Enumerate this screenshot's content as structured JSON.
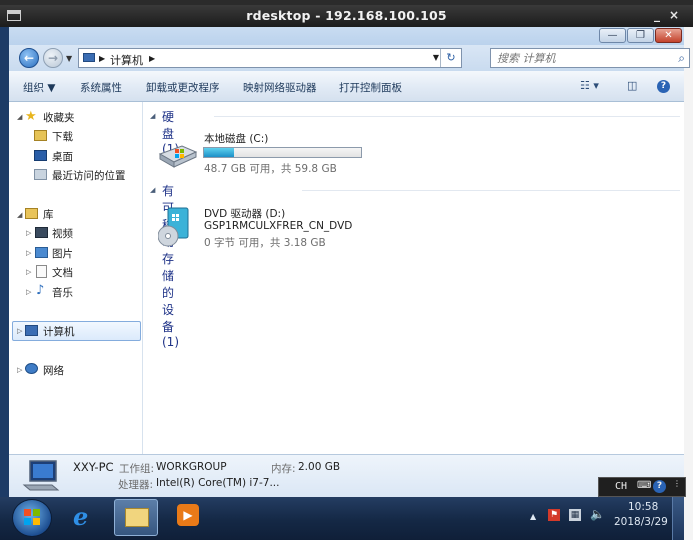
{
  "rdesktop": {
    "title": "rdesktop - 192.168.100.105",
    "minimize": "_",
    "close": "×"
  },
  "address": {
    "crumb": "计算机",
    "search_placeholder": "搜索 计算机"
  },
  "toolbar": {
    "organize": "组织 ▼",
    "properties": "系统属性",
    "uninstall": "卸载或更改程序",
    "map_drive": "映射网络驱动器",
    "control_panel": "打开控制面板"
  },
  "nav": {
    "favorites": "收藏夹",
    "downloads": "下载",
    "desktop": "桌面",
    "recent": "最近访问的位置",
    "libraries": "库",
    "videos": "视频",
    "pictures": "图片",
    "documents": "文档",
    "music": "音乐",
    "computer": "计算机",
    "network": "网络"
  },
  "content": {
    "hdd_group": "硬盘 (1)",
    "removable_group": "有可移动存储的设备 (1)",
    "local_disk_name": "本地磁盘 (C:)",
    "local_disk_space": "48.7 GB 可用，共 59.8 GB",
    "local_disk_used_fraction": 0.19,
    "dvd_name": "DVD 驱动器 (D:)",
    "dvd_label": "GSP1RMCULXFRER_CN_DVD",
    "dvd_space": "0 字节 可用，共 3.18 GB"
  },
  "details": {
    "pc_name": "XXY-PC",
    "workgroup_label": "工作组:",
    "workgroup_value": "WORKGROUP",
    "memory_label": "内存:",
    "memory_value": "2.00 GB",
    "processor_label": "处理器:",
    "processor_value": "Intel(R) Core(TM) i7-7..."
  },
  "ime": {
    "lang": "CH"
  },
  "tray": {
    "time": "10:58",
    "date": "2018/3/29"
  }
}
